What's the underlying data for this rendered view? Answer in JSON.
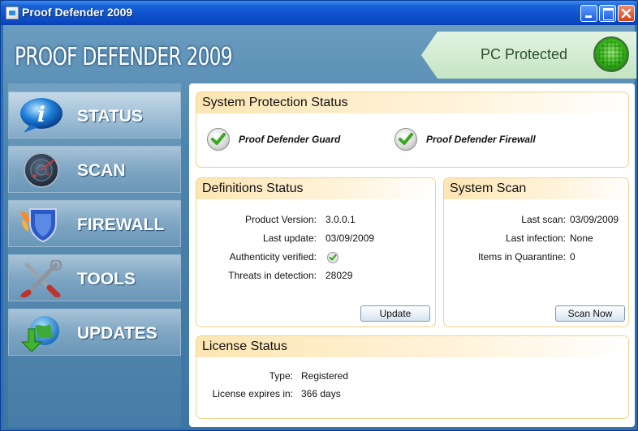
{
  "window": {
    "title": "Proof Defender  2009",
    "controls": {
      "minimize": "minimize",
      "maximize": "maximize",
      "close": "close"
    }
  },
  "brand": "PROOF DEFENDER 2009",
  "status_banner": {
    "label": "PC Protected",
    "indicator_color": "#3fbf20"
  },
  "sidebar": {
    "items": [
      {
        "label": "STATUS",
        "icon": "speech-bubble-icon",
        "active": true
      },
      {
        "label": "SCAN",
        "icon": "radar-icon",
        "active": false
      },
      {
        "label": "FIREWALL",
        "icon": "shield-icon",
        "active": false
      },
      {
        "label": "TOOLS",
        "icon": "tools-icon",
        "active": false
      },
      {
        "label": "UPDATES",
        "icon": "globe-download-icon",
        "active": false
      }
    ]
  },
  "system_protection": {
    "title": "System Protection Status",
    "components": [
      {
        "label": "Proof Defender Guard",
        "icon": "check-icon"
      },
      {
        "label": "Proof Defender Firewall",
        "icon": "check-icon"
      }
    ]
  },
  "definitions": {
    "title": "Definitions Status",
    "rows": [
      {
        "key": "Product Version:",
        "value": "3.0.0.1"
      },
      {
        "key": "Last update:",
        "value": "03/09/2009"
      },
      {
        "key": "Authenticity verified:",
        "value": ""
      },
      {
        "key": "Threats in detection:",
        "value": "28029"
      }
    ],
    "update_button": "Update"
  },
  "system_scan": {
    "title": "System Scan",
    "rows": [
      {
        "key": "Last scan:",
        "value": "03/09/2009"
      },
      {
        "key": "Last infection:",
        "value": "None"
      },
      {
        "key": "Items in Quarantine:",
        "value": "0"
      }
    ],
    "scan_button": "Scan Now"
  },
  "license": {
    "title": "License Status",
    "rows": [
      {
        "key": "Type:",
        "value": "Registered"
      },
      {
        "key": "License expires in:",
        "value": "366 days"
      }
    ]
  },
  "colors": {
    "accent_check": "#3aa822",
    "card_border": "#f0d38a",
    "titlebar": "#0d51cc"
  }
}
